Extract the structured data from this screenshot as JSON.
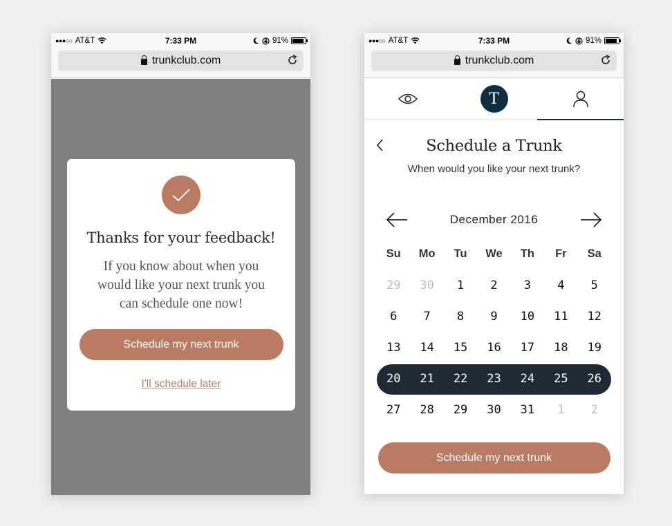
{
  "status_bar": {
    "carrier": "AT&T",
    "time": "7:33 PM",
    "battery_pct": "91%",
    "battery_level": 0.91
  },
  "browser": {
    "url": "trunkclub.com"
  },
  "feedback_modal": {
    "title": "Thanks for your feedback!",
    "body": "If you know about when you would like your next trunk you can schedule one now!",
    "primary_button": "Schedule my next trunk",
    "secondary_link": "I'll schedule later"
  },
  "nav": {
    "tabs": [
      {
        "icon": "eye-icon",
        "active": false
      },
      {
        "icon": "trunkclub-logo",
        "logo_text": "T",
        "active": false
      },
      {
        "icon": "person-icon",
        "active": true
      }
    ]
  },
  "schedule": {
    "title": "Schedule a Trunk",
    "subtitle": "When would you like your next trunk?",
    "month": "December 2016",
    "weekdays": [
      "Su",
      "Mo",
      "Tu",
      "We",
      "Th",
      "Fr",
      "Sa"
    ],
    "weeks": [
      [
        {
          "d": "29",
          "muted": true
        },
        {
          "d": "30",
          "muted": true
        },
        {
          "d": "1"
        },
        {
          "d": "2"
        },
        {
          "d": "3"
        },
        {
          "d": "4"
        },
        {
          "d": "5"
        }
      ],
      [
        {
          "d": "6"
        },
        {
          "d": "7"
        },
        {
          "d": "8"
        },
        {
          "d": "9"
        },
        {
          "d": "10"
        },
        {
          "d": "11"
        },
        {
          "d": "12"
        }
      ],
      [
        {
          "d": "13"
        },
        {
          "d": "14"
        },
        {
          "d": "15"
        },
        {
          "d": "16"
        },
        {
          "d": "17"
        },
        {
          "d": "18"
        },
        {
          "d": "19"
        }
      ],
      [
        {
          "d": "20",
          "selected": true
        },
        {
          "d": "21",
          "selected": true
        },
        {
          "d": "22",
          "selected": true
        },
        {
          "d": "23",
          "selected": true
        },
        {
          "d": "24",
          "selected": true
        },
        {
          "d": "25",
          "selected": true
        },
        {
          "d": "26",
          "selected": true
        }
      ],
      [
        {
          "d": "27"
        },
        {
          "d": "28"
        },
        {
          "d": "29"
        },
        {
          "d": "30"
        },
        {
          "d": "31"
        },
        {
          "d": "1",
          "muted": true
        },
        {
          "d": "2",
          "muted": true
        }
      ]
    ],
    "selected_week_index": 3,
    "button": "Schedule my next trunk"
  },
  "colors": {
    "accent": "#b97c62",
    "dark": "#1f2a35",
    "logo": "#0f2e3f",
    "overlay": "#808080"
  }
}
